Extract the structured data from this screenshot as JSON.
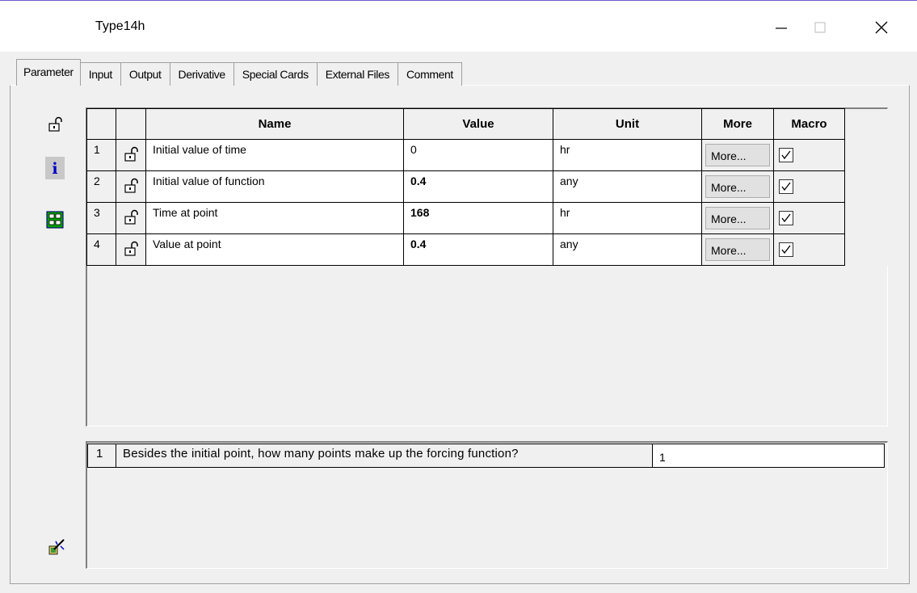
{
  "window": {
    "title": "Type14h",
    "minimize_glyph": "—",
    "maximize_glyph": "☐",
    "close_glyph": "✕"
  },
  "tabs": [
    {
      "label": "Parameter",
      "active": true
    },
    {
      "label": "Input",
      "active": false
    },
    {
      "label": "Output",
      "active": false
    },
    {
      "label": "Derivative",
      "active": false
    },
    {
      "label": "Special Cards",
      "active": false
    },
    {
      "label": "External Files",
      "active": false
    },
    {
      "label": "Comment",
      "active": false
    }
  ],
  "side_icons": [
    "lock-icon",
    "info-icon",
    "grid-layout-icon",
    "wizard-icon"
  ],
  "grid": {
    "headers": {
      "name": "Name",
      "value": "Value",
      "unit": "Unit",
      "more": "More",
      "macro": "Macro"
    },
    "rows": [
      {
        "num": "1",
        "name": "Initial value of time",
        "value": "0",
        "value_bold": false,
        "unit": "hr",
        "more": "More...",
        "macro": true
      },
      {
        "num": "2",
        "name": "Initial value of function",
        "value": "0.4",
        "value_bold": true,
        "unit": "any",
        "more": "More...",
        "macro": true
      },
      {
        "num": "3",
        "name": "Time at point",
        "value": "168",
        "value_bold": true,
        "unit": "hr",
        "more": "More...",
        "macro": true
      },
      {
        "num": "4",
        "name": "Value at point",
        "value": "0.4",
        "value_bold": true,
        "unit": "any",
        "more": "More...",
        "macro": true
      }
    ]
  },
  "question": {
    "num": "1",
    "text": "Besides the initial point, how many points make up the forcing function?",
    "value": "1"
  },
  "colors": {
    "background": "#f0f0f0",
    "accent_topline": "#6a5acd",
    "info_blue": "#0000c8",
    "grid_icon_green": "#00a000"
  }
}
